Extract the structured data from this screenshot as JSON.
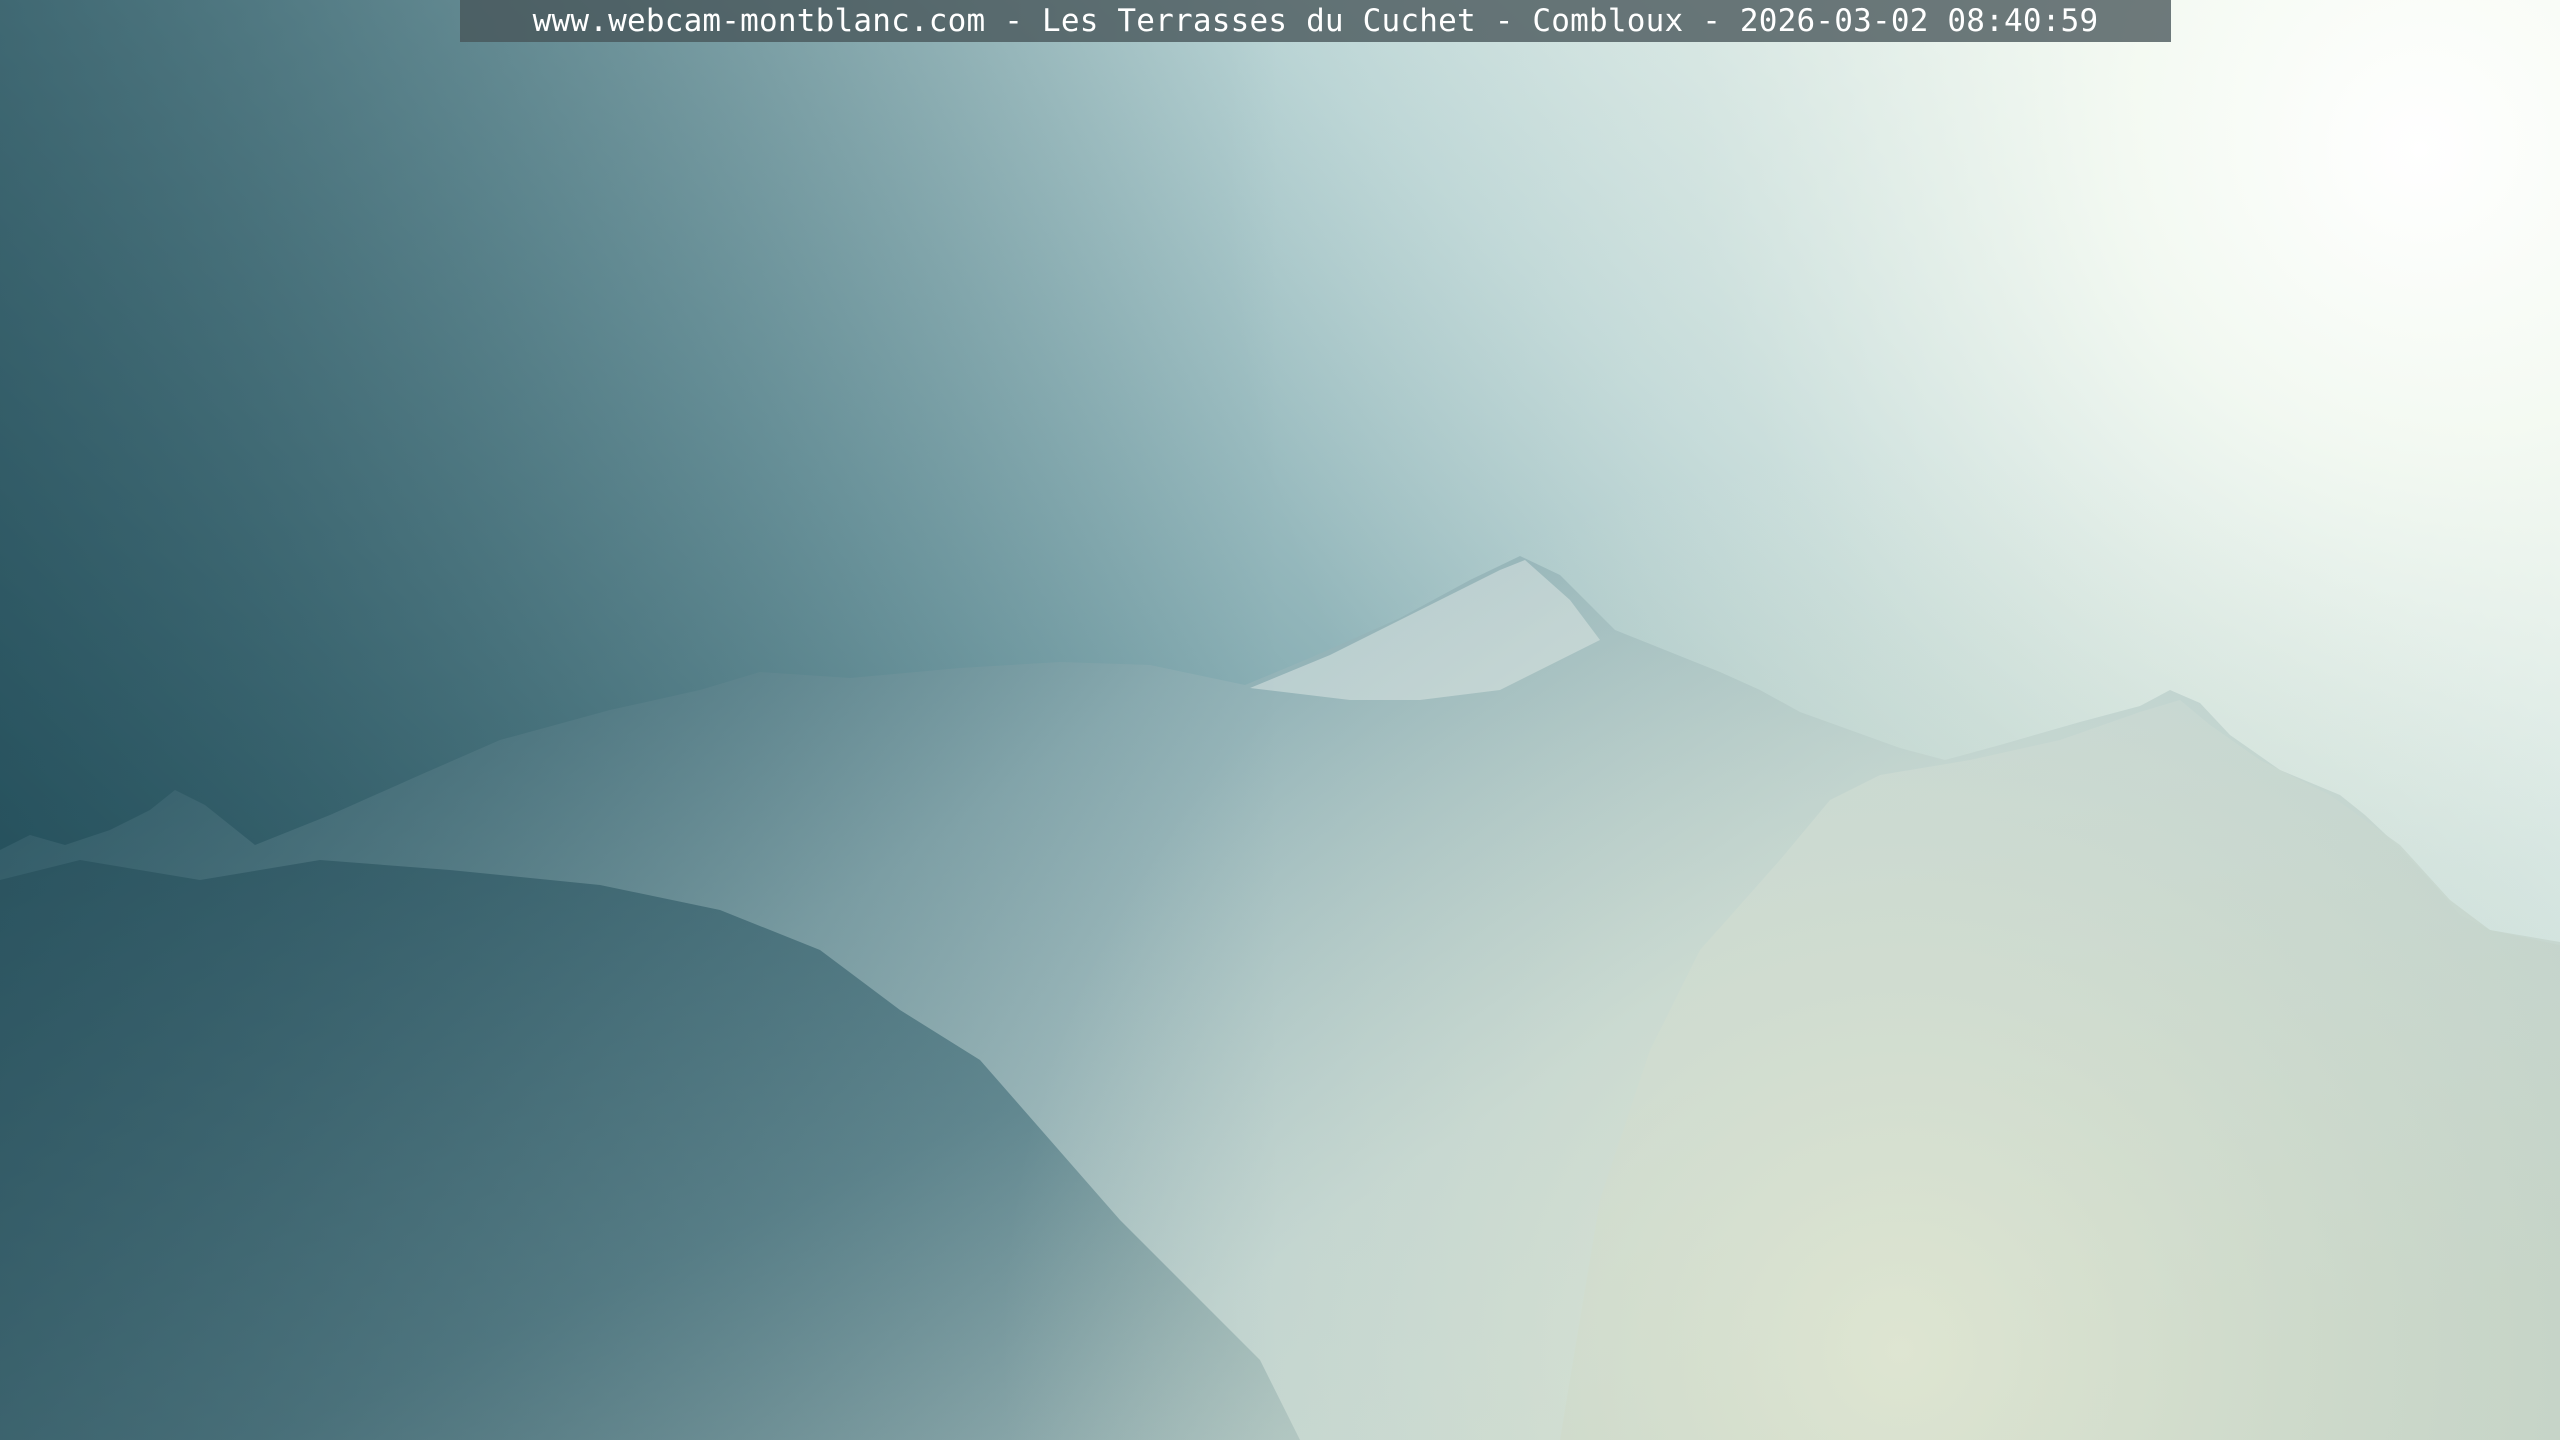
{
  "webcam": {
    "caption": "www.webcam-montblanc.com - Les Terrasses du Cuchet - Combloux - 2026-03-02 08:40:59"
  },
  "scene": {
    "subject": "snow-covered-mountain-massif",
    "lighting": "strong-sun-glare-top-right",
    "colors": {
      "sky_dark": "#31636e",
      "sky_mid": "#9fc1c4",
      "sky_bright": "#f3faf4",
      "mountain_shadow": "#3f6c78",
      "mountain_lit": "#c6d8d5",
      "haze": "#dfe6d2"
    }
  }
}
